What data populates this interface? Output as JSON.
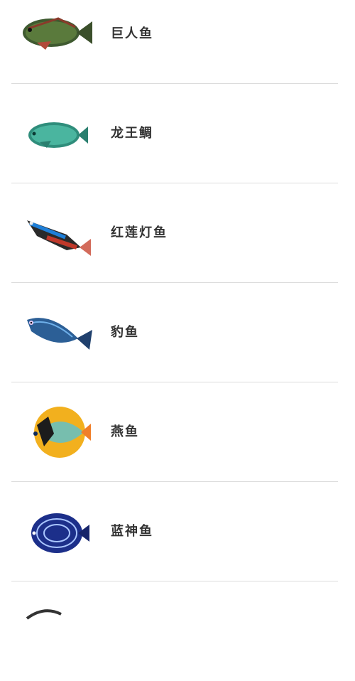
{
  "fish_list": {
    "items": [
      {
        "name": "巨人鱼",
        "icon": "striped-fish-icon",
        "color": "#4a6a3a"
      },
      {
        "name": "龙王鲷",
        "icon": "green-wrasse-icon",
        "color": "#3aa08a"
      },
      {
        "name": "红莲灯鱼",
        "icon": "neon-tetra-icon",
        "color": "#c0392b"
      },
      {
        "name": "豹鱼",
        "icon": "blue-spotted-fish-icon",
        "color": "#2e6fb0"
      },
      {
        "name": "燕鱼",
        "icon": "angelfish-yellow-icon",
        "color": "#f2b01e"
      },
      {
        "name": "蓝神鱼",
        "icon": "emperor-angelfish-icon",
        "color": "#1c2f8a"
      },
      {
        "name": "",
        "icon": "fish-icon-partial",
        "color": "#333333"
      }
    ]
  }
}
